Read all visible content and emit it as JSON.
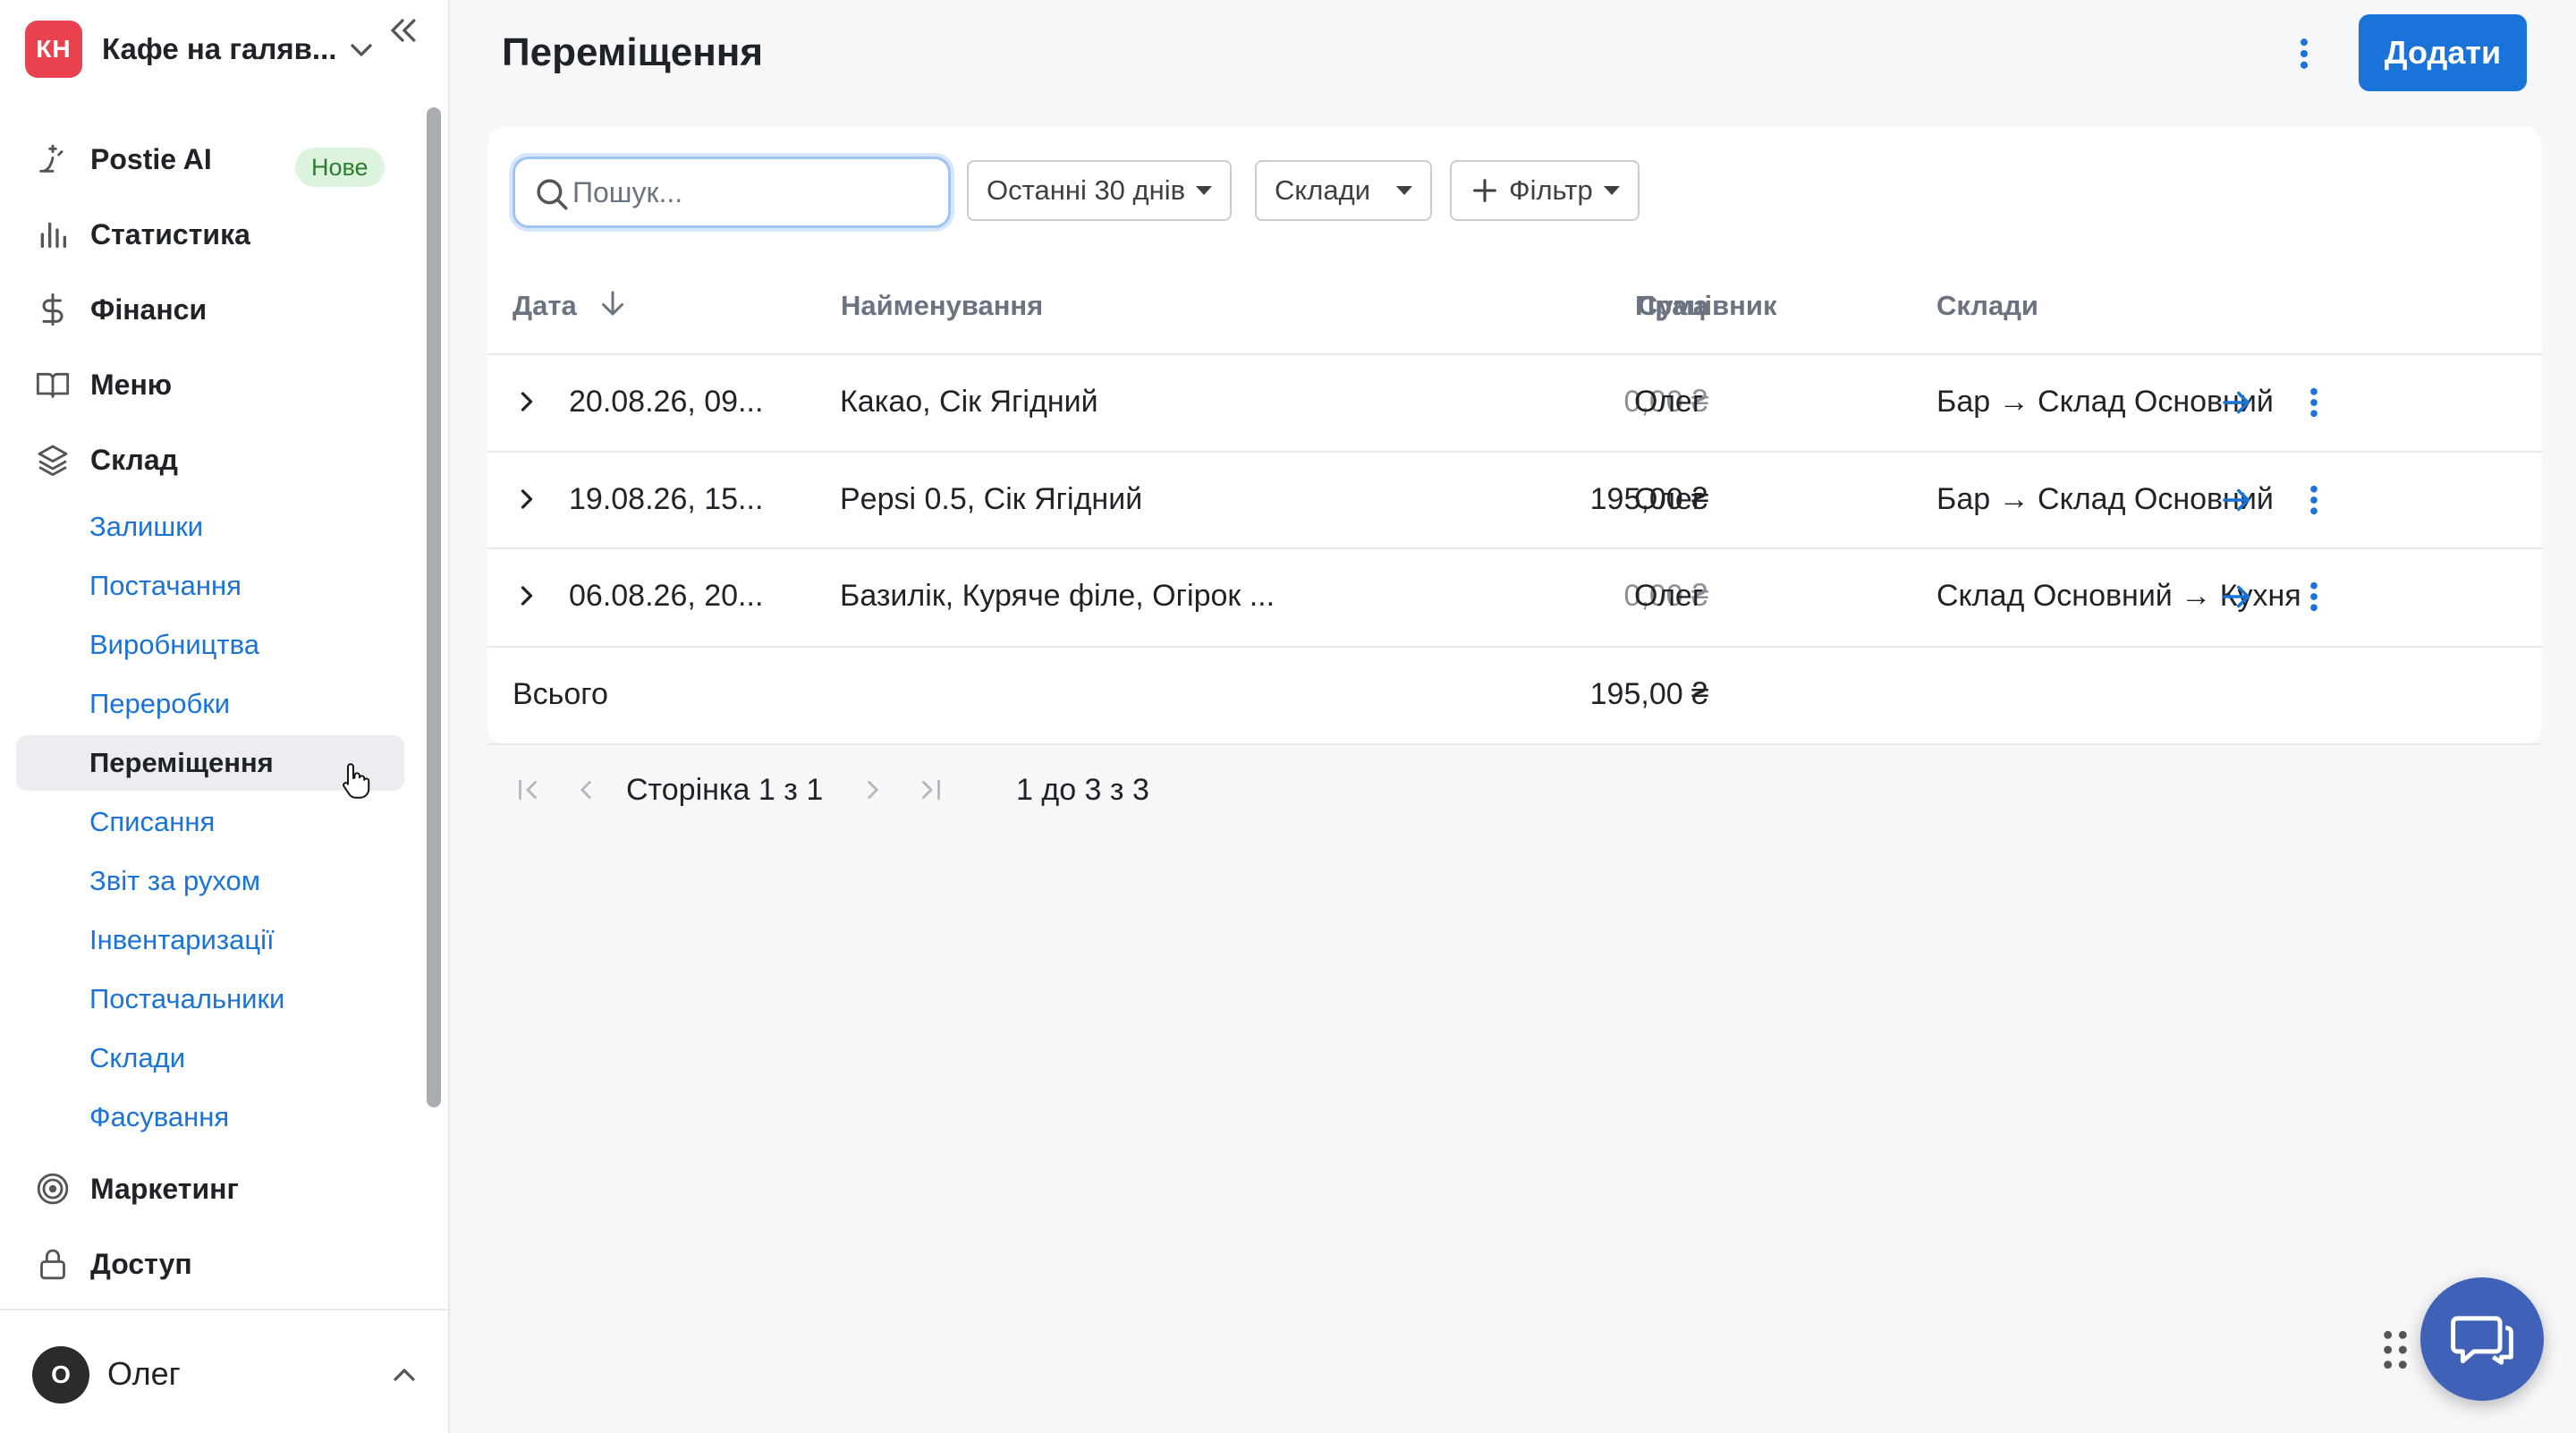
{
  "venue": {
    "initials": "КН",
    "name": "Кафе на галяв..."
  },
  "nav": {
    "postie": {
      "label": "Postie AI",
      "badge": "Нове"
    },
    "statistics": "Статистика",
    "finance": "Фінанси",
    "menu": "Меню",
    "warehouse": "Склад",
    "warehouse_items": [
      "Залишки",
      "Постачання",
      "Виробництва",
      "Переробки",
      "Переміщення",
      "Списання",
      "Звіт за рухом",
      "Інвентаризації",
      "Постачальники",
      "Склади",
      "Фасування"
    ],
    "marketing": "Маркетинг",
    "access": "Доступ"
  },
  "user": {
    "initial": "О",
    "name": "Олег"
  },
  "page": {
    "title": "Переміщення",
    "add_label": "Додати"
  },
  "toolbar": {
    "search_placeholder": "Пошук...",
    "period": "Останні 30 днів",
    "warehouses": "Склади",
    "filter": "Фільтр"
  },
  "table": {
    "headers": {
      "date": "Дата",
      "name": "Найменування",
      "sum": "Сума",
      "employee": "Працівник",
      "warehouses": "Склади"
    },
    "rows": [
      {
        "date": "20.08.26, 09...",
        "name": "Какао, Сік Ягідний",
        "sum": "0,00 ₴",
        "employee": "Олег",
        "route": "Бар → Склад Основний"
      },
      {
        "date": "19.08.26, 15...",
        "name": "Pepsi 0.5, Сік Ягідний",
        "sum": "195,00 ₴",
        "employee": "Олег",
        "route": "Бар → Склад Основний"
      },
      {
        "date": "06.08.26, 20...",
        "name": "Базилік, Куряче філе, Огірок ...",
        "sum": "0,00 ₴",
        "employee": "Олег",
        "route": "Склад Основний → Кухня"
      }
    ],
    "total_label": "Всього",
    "total_sum": "195,00 ₴"
  },
  "pagination": {
    "page_word": "Сторінка",
    "current": "1",
    "of_word": "з",
    "total": "1",
    "range": "1 до 3 з 3"
  },
  "colors": {
    "accent": "#1a73d9",
    "logo": "#e9414f",
    "badge_bg": "#dcf3dd",
    "chat": "#3f62b8"
  }
}
